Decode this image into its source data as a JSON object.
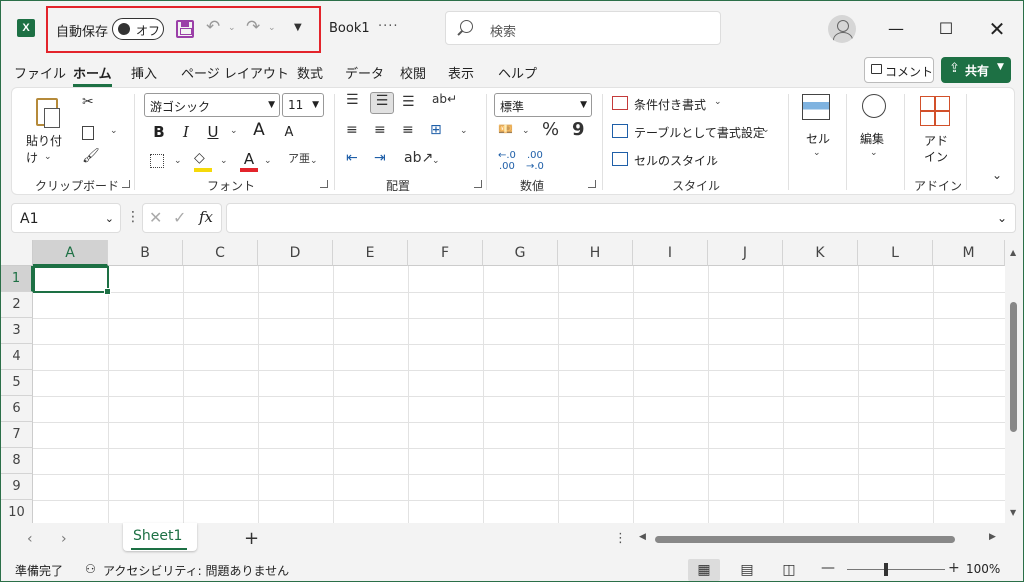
{
  "titlebar": {
    "app_icon": "excel-logo",
    "autosave_label": "自動保存",
    "autosave_state": "オフ",
    "doc_title": "Book1",
    "doc_more": "····",
    "search_placeholder": "検索",
    "window_controls": [
      "minimize",
      "maximize",
      "close"
    ]
  },
  "menu": {
    "tabs": [
      "ファイル",
      "ホーム",
      "挿入",
      "ページ レイアウト",
      "数式",
      "データ",
      "校閲",
      "表示",
      "ヘルプ"
    ],
    "active_tab": "ホーム",
    "comment_label": "コメント",
    "share_label": "共有"
  },
  "ribbon": {
    "clipboard": {
      "paste_label": "貼り付け",
      "group_label": "クリップボード"
    },
    "font": {
      "font_name": "游ゴシック",
      "font_size": "11",
      "bold": "B",
      "italic": "I",
      "underline": "U",
      "grow": "A",
      "shrink": "A",
      "font_color_letter": "A",
      "group_label": "フォント"
    },
    "alignment": {
      "group_label": "配置"
    },
    "number": {
      "format": "標準",
      "percent": "%",
      "comma": "9",
      "group_label": "数値"
    },
    "styles": {
      "conditional": "条件付き書式",
      "as_table": "テーブルとして書式設定",
      "cell_styles": "セルのスタイル",
      "group_label": "スタイル"
    },
    "cells": {
      "label": "セル"
    },
    "editing": {
      "label": "編集"
    },
    "addins": {
      "label_line1": "アド",
      "label_line2": "イン",
      "group_label": "アドイン"
    }
  },
  "formula_bar": {
    "name_box": "A1",
    "fx": "fx",
    "formula": ""
  },
  "grid": {
    "columns": [
      "A",
      "B",
      "C",
      "D",
      "E",
      "F",
      "G",
      "H",
      "I",
      "J",
      "K",
      "L",
      "M"
    ],
    "rows": [
      "1",
      "2",
      "3",
      "4",
      "5",
      "6",
      "7",
      "8",
      "9",
      "10"
    ],
    "active_cell": "A1"
  },
  "sheets": {
    "tabs": [
      "Sheet1"
    ],
    "active": "Sheet1",
    "add_label": "+"
  },
  "status": {
    "ready": "準備完了",
    "accessibility": "アクセシビリティ: 問題ありません",
    "zoom": "100%"
  },
  "colors": {
    "accent": "#1d7044",
    "highlight_box": "#e3242b",
    "save_icon": "#9b3fa8"
  }
}
